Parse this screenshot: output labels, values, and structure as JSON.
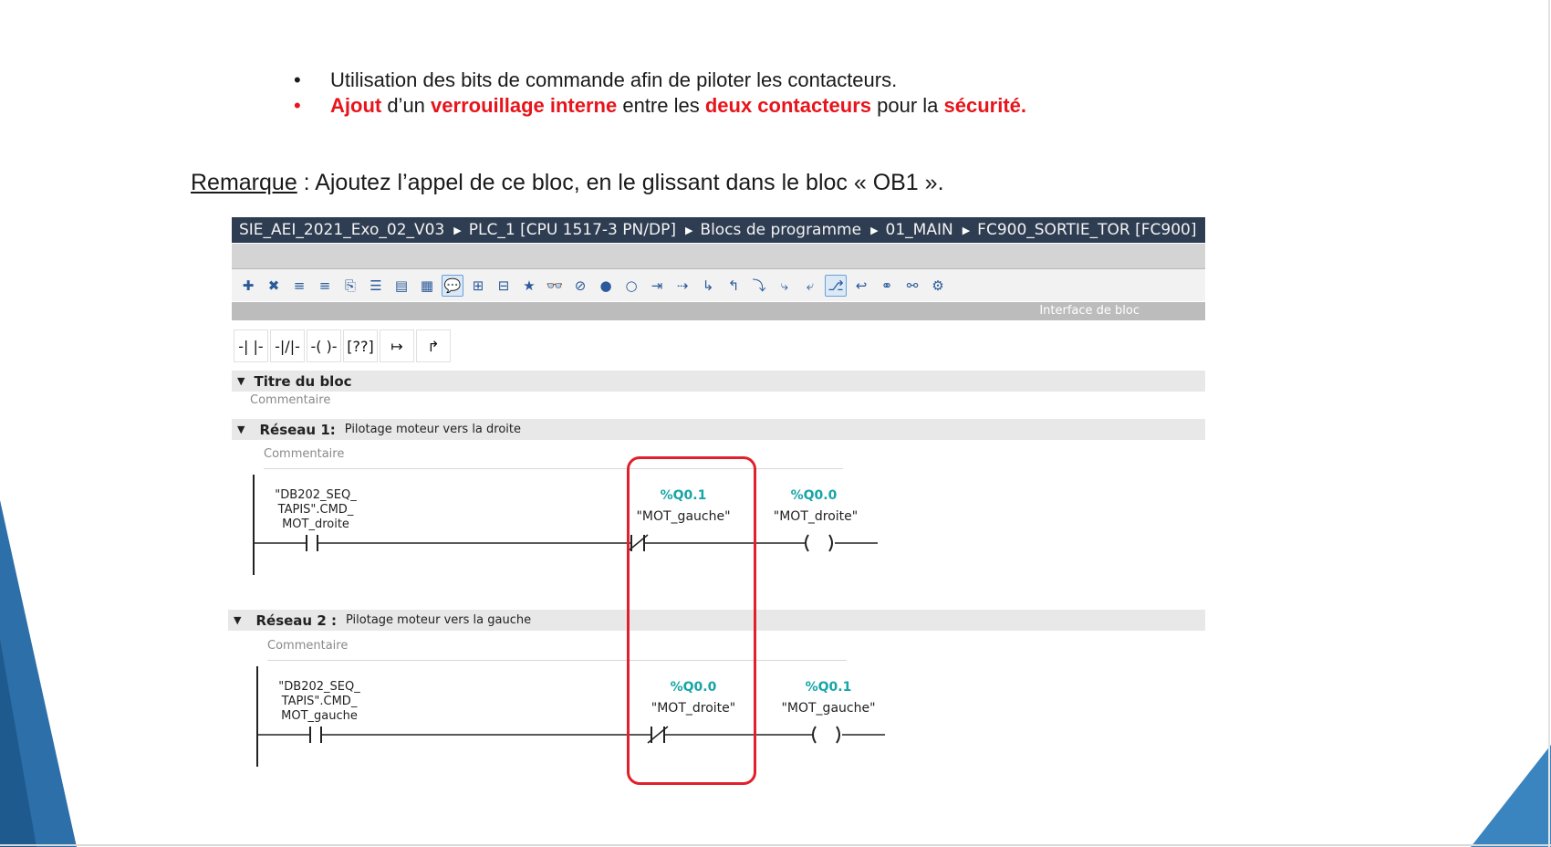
{
  "slide": {
    "bullets": [
      {
        "marker": "•",
        "text": "Utilisation des bits de commande afin de piloter les contacteurs."
      },
      {
        "marker": "•",
        "parts": [
          "Ajout",
          " d’un ",
          "verrouillage interne",
          " entre les ",
          "deux contacteurs",
          " pour la ",
          "sécurité."
        ]
      }
    ],
    "remark": {
      "label": "Remarque",
      "text": " : Ajoutez l’appel de ce bloc, en le glissant dans le bloc « OB1 »."
    }
  },
  "tia": {
    "breadcrumb": [
      "SIE_AEI_2021_Exo_02_V03",
      "PLC_1 [CPU 1517-3 PN/DP]",
      "Blocs de programme",
      "01_MAIN",
      "FC900_SORTIE_TOR [FC900]"
    ],
    "interface_label": "Interface de bloc",
    "toolbar_icons": [
      "insert-network-icon",
      "delete-network-icon",
      "insert-row-icon",
      "append-row-icon",
      "delete-row-icon",
      "network-list-icon",
      "absolute-operand-icon",
      "symbolic-operand-icon",
      "comment-icon",
      "network-expand-icon",
      "network-collapse-icon",
      "favorites-icon",
      "monitor-icon",
      "delete-monitor-icon",
      "breakpoint-icon",
      "breakpoint-remove-icon",
      "step-icon",
      "goto-icon",
      "jump-in-icon",
      "jump-out-icon",
      "next-icon",
      "next-step-icon",
      "prev-step-icon",
      "call-icon",
      "return-icon",
      "reference-icon",
      "cross-ref-icon",
      "settings-icon"
    ],
    "ladder_tools": [
      "-| |-",
      "-|/|-",
      "-( )-",
      "[??]",
      "↦",
      "↱"
    ],
    "block_title": "Titre du bloc",
    "comment_placeholder": "Commentaire",
    "networks": [
      {
        "label": "Réseau 1:",
        "description": "Pilotage moteur vers la droite",
        "comment": "Commentaire",
        "contact_no": {
          "line1": "\"DB202_SEQ_",
          "line2": "TAPIS\".CMD_",
          "line3": "MOT_droite"
        },
        "contact_nc": {
          "address": "%Q0.1",
          "symbol": "\"MOT_gauche\""
        },
        "coil": {
          "address": "%Q0.0",
          "symbol": "\"MOT_droite\""
        }
      },
      {
        "label": "Réseau 2 :",
        "description": "Pilotage moteur vers la gauche",
        "comment": "Commentaire",
        "contact_no": {
          "line1": "\"DB202_SEQ_",
          "line2": "TAPIS\".CMD_",
          "line3": "MOT_gauche"
        },
        "contact_nc": {
          "address": "%Q0.0",
          "symbol": "\"MOT_droite\""
        },
        "coil": {
          "address": "%Q0.1",
          "symbol": "\"MOT_gauche\""
        }
      }
    ]
  },
  "colors": {
    "accent_red": "#e8141b",
    "address_teal": "#17a5a7",
    "highlight": "#e0202c",
    "deco_blue": "#2a6ea8"
  }
}
